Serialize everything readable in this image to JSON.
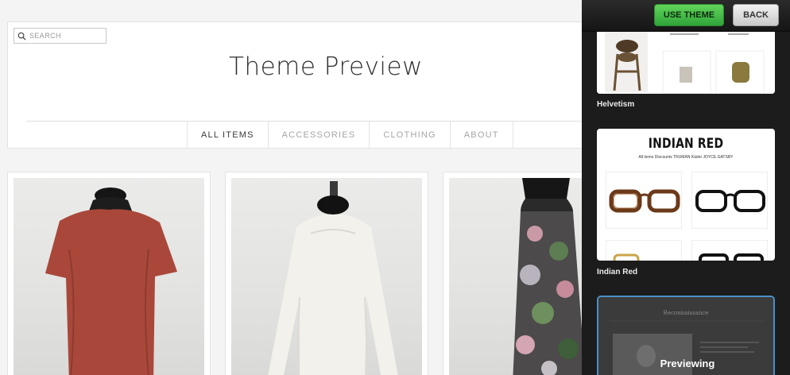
{
  "site": {
    "title": "Theme Preview",
    "search_placeholder": "SEARCH",
    "nav": [
      "ALL ITEMS",
      "ACCESSORIES",
      "CLOTHING",
      "ABOUT"
    ]
  },
  "toolbar": {
    "use_theme_label": "USE THEME",
    "back_label": "BACK"
  },
  "themes": [
    {
      "name": "Helvetism"
    },
    {
      "name": "Indian Red",
      "thumb_title": "INDIAN RED",
      "thumb_nav": "All items   Discounts   TRUMAN   Käder   JOYCE   GATSBY"
    },
    {
      "name": "Reconnaissance",
      "status": "Previewing"
    }
  ],
  "colors": {
    "accent_green": "#3bb84a",
    "sidebar_bg": "#1c1c1c",
    "selected_border": "#4a90c8"
  }
}
